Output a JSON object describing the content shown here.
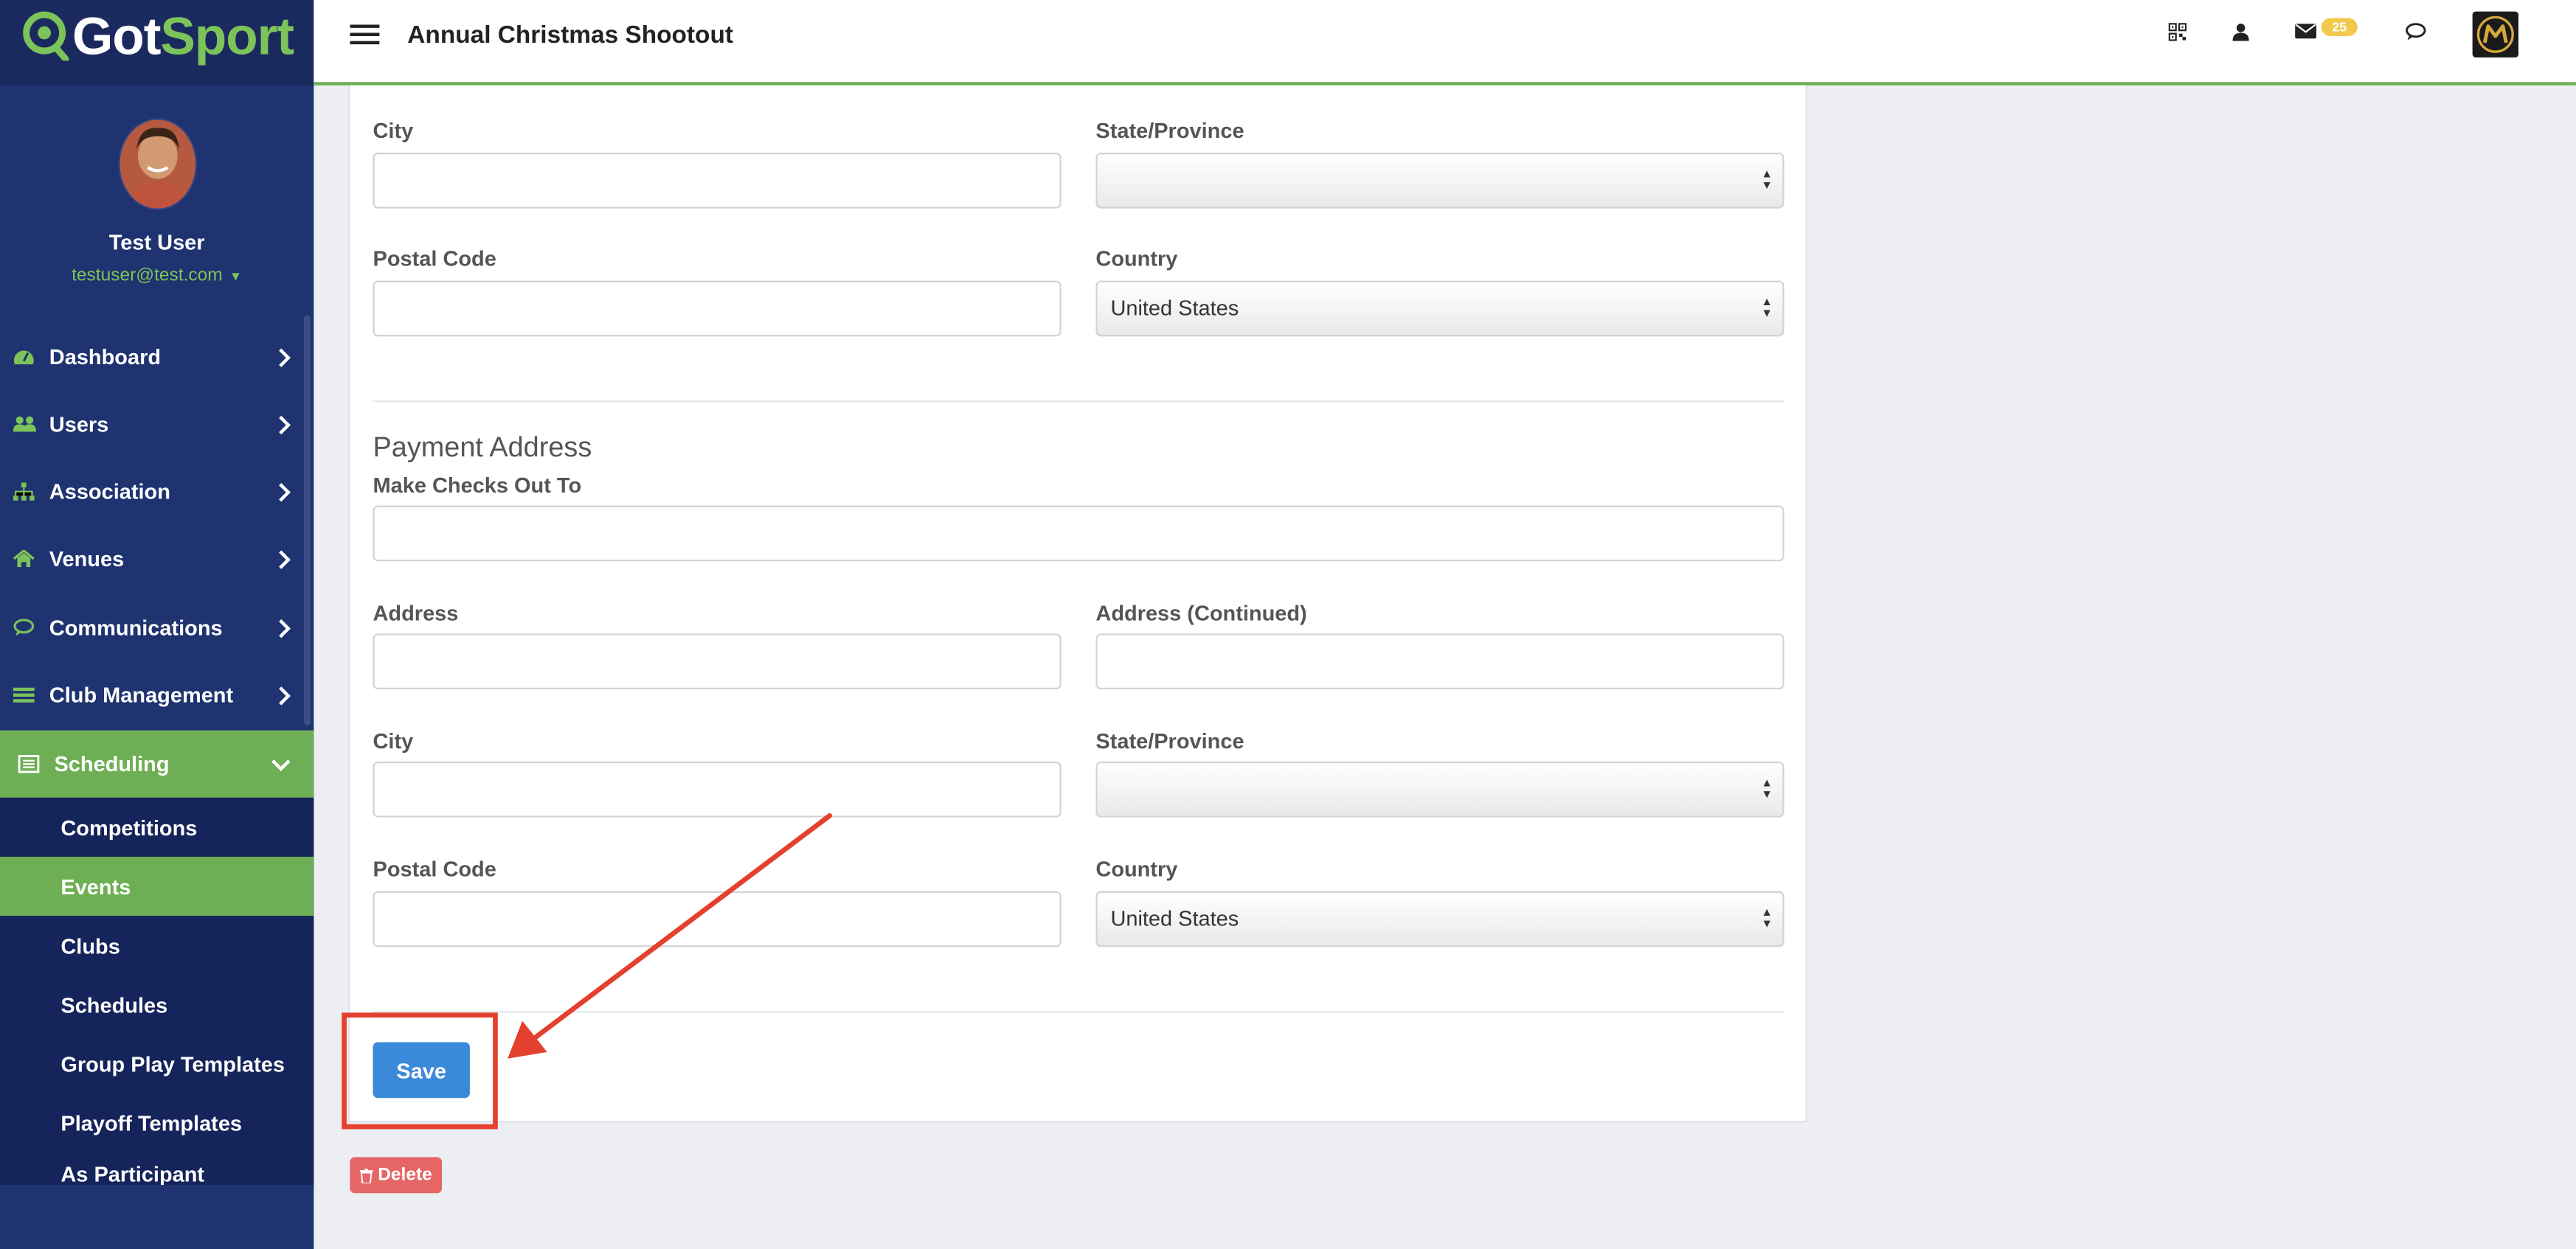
{
  "brand": {
    "part1": "Got",
    "part2": "Sport"
  },
  "header": {
    "title": "Annual Christmas Shootout",
    "notification_count": "25"
  },
  "user": {
    "name": "Test User",
    "email": "testuser@test.com"
  },
  "sidebar": {
    "items": [
      {
        "label": "Dashboard"
      },
      {
        "label": "Users"
      },
      {
        "label": "Association"
      },
      {
        "label": "Venues"
      },
      {
        "label": "Communications"
      },
      {
        "label": "Club Management"
      },
      {
        "label": "Scheduling"
      }
    ],
    "sub_items": [
      {
        "label": "Competitions"
      },
      {
        "label": "Events"
      },
      {
        "label": "Clubs"
      },
      {
        "label": "Schedules"
      },
      {
        "label": "Group Play Templates"
      },
      {
        "label": "Playoff Templates"
      },
      {
        "label": "As Participant"
      }
    ]
  },
  "form": {
    "top": {
      "city_label": "City",
      "city_value": "",
      "state_label": "State/Province",
      "state_value": "",
      "postal_label": "Postal Code",
      "postal_value": "",
      "country_label": "Country",
      "country_value": "United States"
    },
    "payment": {
      "section_title": "Payment Address",
      "checks_label": "Make Checks Out To",
      "checks_value": "",
      "address_label": "Address",
      "address_value": "",
      "address2_label": "Address (Continued)",
      "address2_value": "",
      "city_label": "City",
      "city_value": "",
      "state_label": "State/Province",
      "state_value": "",
      "postal_label": "Postal Code",
      "postal_value": "",
      "country_label": "Country",
      "country_value": "United States"
    }
  },
  "actions": {
    "save_label": "Save",
    "delete_label": "Delete"
  },
  "colors": {
    "sidebar_bg": "#1e3370",
    "accent_green": "#6eaf55",
    "save_blue": "#3a8ad9",
    "delete_red": "#e66565",
    "annotation_red": "#e3402f"
  }
}
